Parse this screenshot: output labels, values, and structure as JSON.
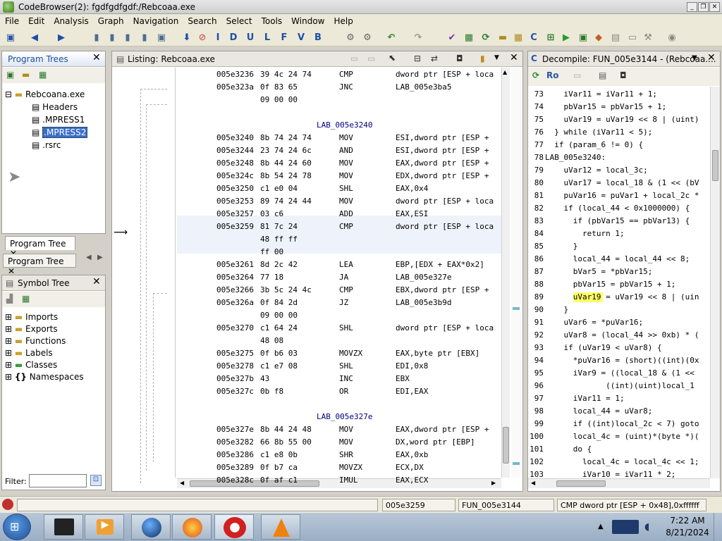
{
  "window": {
    "title": "CodeBrowser(2): fgdfgdfgdf:/Rebcoaa.exe"
  },
  "menu": [
    "File",
    "Edit",
    "Analysis",
    "Graph",
    "Navigation",
    "Search",
    "Select",
    "Tools",
    "Window",
    "Help"
  ],
  "program_trees": {
    "title": "Program Trees",
    "root": "Rebcoana.exe",
    "items": [
      "Headers",
      ".MPRESS1",
      ".MPRESS2",
      ".rsrc"
    ],
    "tabs": [
      "Program Tree",
      "Program Tree"
    ]
  },
  "symbol_tree": {
    "title": "Symbol Tree",
    "items": [
      "Imports",
      "Exports",
      "Functions",
      "Labels",
      "Classes",
      "Namespaces"
    ],
    "filter_label": "Filter:"
  },
  "listing": {
    "title": "Listing:  Rebcoaa.exe",
    "rows": [
      {
        "a": "005e3236",
        "b": "39 4c 24 74",
        "m": "CMP",
        "o": "dword ptr [ESP + loca"
      },
      {
        "a": "005e323a",
        "b": "0f 83 65",
        "m": "JNC",
        "o": "LAB_005e3ba5"
      },
      {
        "a": "",
        "b": "09 00 00",
        "m": "",
        "o": ""
      },
      {
        "a": "",
        "b": "",
        "m": "",
        "o": ""
      },
      {
        "label": "LAB_005e3240"
      },
      {
        "a": "005e3240",
        "b": "8b 74 24 74",
        "m": "MOV",
        "o": "ESI,dword ptr [ESP +"
      },
      {
        "a": "005e3244",
        "b": "23 74 24 6c",
        "m": "AND",
        "o": "ESI,dword ptr [ESP +"
      },
      {
        "a": "005e3248",
        "b": "8b 44 24 60",
        "m": "MOV",
        "o": "EAX,dword ptr [ESP +"
      },
      {
        "a": "005e324c",
        "b": "8b 54 24 78",
        "m": "MOV",
        "o": "EDX,dword ptr [ESP +"
      },
      {
        "a": "005e3250",
        "b": "c1 e0 04",
        "m": "SHL",
        "o": "EAX,0x4"
      },
      {
        "a": "005e3253",
        "b": "89 74 24 44",
        "m": "MOV",
        "o": "dword ptr [ESP + loca"
      },
      {
        "a": "005e3257",
        "b": "03 c6",
        "m": "ADD",
        "o": "EAX,ESI"
      },
      {
        "a": "005e3259",
        "b": "81 7c 24",
        "m": "CMP",
        "o": "dword ptr [ESP + loca"
      },
      {
        "a": "",
        "b": "48 ff ff",
        "m": "",
        "o": ""
      },
      {
        "a": "",
        "b": "ff 00",
        "m": "",
        "o": ""
      },
      {
        "a": "005e3261",
        "b": "8d 2c 42",
        "m": "LEA",
        "o": "EBP,[EDX + EAX*0x2]"
      },
      {
        "a": "005e3264",
        "b": "77 18",
        "m": "JA",
        "o": "LAB_005e327e"
      },
      {
        "a": "005e3266",
        "b": "3b 5c 24 4c",
        "m": "CMP",
        "o": "EBX,dword ptr [ESP +"
      },
      {
        "a": "005e326a",
        "b": "0f 84 2d",
        "m": "JZ",
        "o": "LAB_005e3b9d"
      },
      {
        "a": "",
        "b": "09 00 00",
        "m": "",
        "o": ""
      },
      {
        "a": "005e3270",
        "b": "c1 64 24",
        "m": "SHL",
        "o": "dword ptr [ESP + loca"
      },
      {
        "a": "",
        "b": "48 08",
        "m": "",
        "o": ""
      },
      {
        "a": "005e3275",
        "b": "0f b6 03",
        "m": "MOVZX",
        "o": "EAX,byte ptr [EBX]"
      },
      {
        "a": "005e3278",
        "b": "c1 e7 08",
        "m": "SHL",
        "o": "EDI,0x8"
      },
      {
        "a": "005e327b",
        "b": "43",
        "m": "INC",
        "o": "EBX"
      },
      {
        "a": "005e327c",
        "b": "0b f8",
        "m": "OR",
        "o": "EDI,EAX"
      },
      {
        "a": "",
        "b": "",
        "m": "",
        "o": ""
      },
      {
        "label": "LAB_005e327e"
      },
      {
        "a": "005e327e",
        "b": "8b 44 24 48",
        "m": "MOV",
        "o": "EAX,dword ptr [ESP +"
      },
      {
        "a": "005e3282",
        "b": "66 8b 55 00",
        "m": "MOV",
        "o": "DX,word ptr [EBP]"
      },
      {
        "a": "005e3286",
        "b": "c1 e8 0b",
        "m": "SHR",
        "o": "EAX,0xb"
      },
      {
        "a": "005e3289",
        "b": "0f b7 ca",
        "m": "MOVZX",
        "o": "ECX,DX"
      },
      {
        "a": "005e328c",
        "b": "0f af c1",
        "m": "IMUL",
        "o": "EAX,ECX"
      }
    ]
  },
  "decompile": {
    "title": "Decompile: FUN_005e3144 - (Rebcoaa....",
    "lines": [
      {
        "n": "73",
        "t": "    iVar11 = iVar11 + 1;"
      },
      {
        "n": "74",
        "t": "    pbVar15 = pbVar15 + 1;"
      },
      {
        "n": "75",
        "t": "    uVar19 = uVar19 << 8 | (uint)"
      },
      {
        "n": "76",
        "t": "  } while (iVar11 < 5);"
      },
      {
        "n": "77",
        "t": "  if (param_6 != 0) {"
      },
      {
        "n": "78",
        "t": "LAB_005e3240:"
      },
      {
        "n": "79",
        "t": "    uVar12 = local_3c;"
      },
      {
        "n": "80",
        "t": "    uVar17 = local_18 & (1 << (bV"
      },
      {
        "n": "81",
        "t": "    puVar16 = puVar1 + local_2c *"
      },
      {
        "n": "82",
        "t": "    if (local_44 < 0x1000000) {"
      },
      {
        "n": "83",
        "t": "      if (pbVar15 == pbVar13) {"
      },
      {
        "n": "84",
        "t": "        return 1;"
      },
      {
        "n": "85",
        "t": "      }"
      },
      {
        "n": "86",
        "t": "      local_44 = local_44 << 8;"
      },
      {
        "n": "87",
        "t": "      bVar5 = *pbVar15;"
      },
      {
        "n": "88",
        "t": "      pbVar15 = pbVar15 + 1;"
      },
      {
        "n": "89",
        "t": "      uVar19 = uVar19 << 8 | (uin"
      },
      {
        "n": "90",
        "t": "    }"
      },
      {
        "n": "91",
        "t": "    uVar6 = *puVar16;"
      },
      {
        "n": "92",
        "t": "    uVar8 = (local_44 >> 0xb) * ("
      },
      {
        "n": "93",
        "t": "    if (uVar19 < uVar8) {"
      },
      {
        "n": "94",
        "t": "      *puVar16 = (short)((int)(0x"
      },
      {
        "n": "95",
        "t": "      iVar9 = ((local_18 & (1 <<"
      },
      {
        "n": "96",
        "t": "             ((int)(uint)local_1"
      },
      {
        "n": "97",
        "t": "      iVar11 = 1;"
      },
      {
        "n": "98",
        "t": "      local_44 = uVar8;"
      },
      {
        "n": "99",
        "t": "      if ((int)local_2c < 7) goto"
      },
      {
        "n": "100",
        "t": "      local_4c = (uint)*(byte *)("
      },
      {
        "n": "101",
        "t": "      do {"
      },
      {
        "n": "102",
        "t": "        local_4c = local_4c << 1;"
      },
      {
        "n": "103",
        "t": "        iVar10 = iVar11 * 2;"
      }
    ]
  },
  "status": {
    "address": "005e3259",
    "function": "FUN_005e3144",
    "instruction": "CMP dword ptr [ESP + 0x48],0xffffff"
  },
  "taskbar": {
    "time": "7:22 AM",
    "date": "8/21/2024"
  }
}
